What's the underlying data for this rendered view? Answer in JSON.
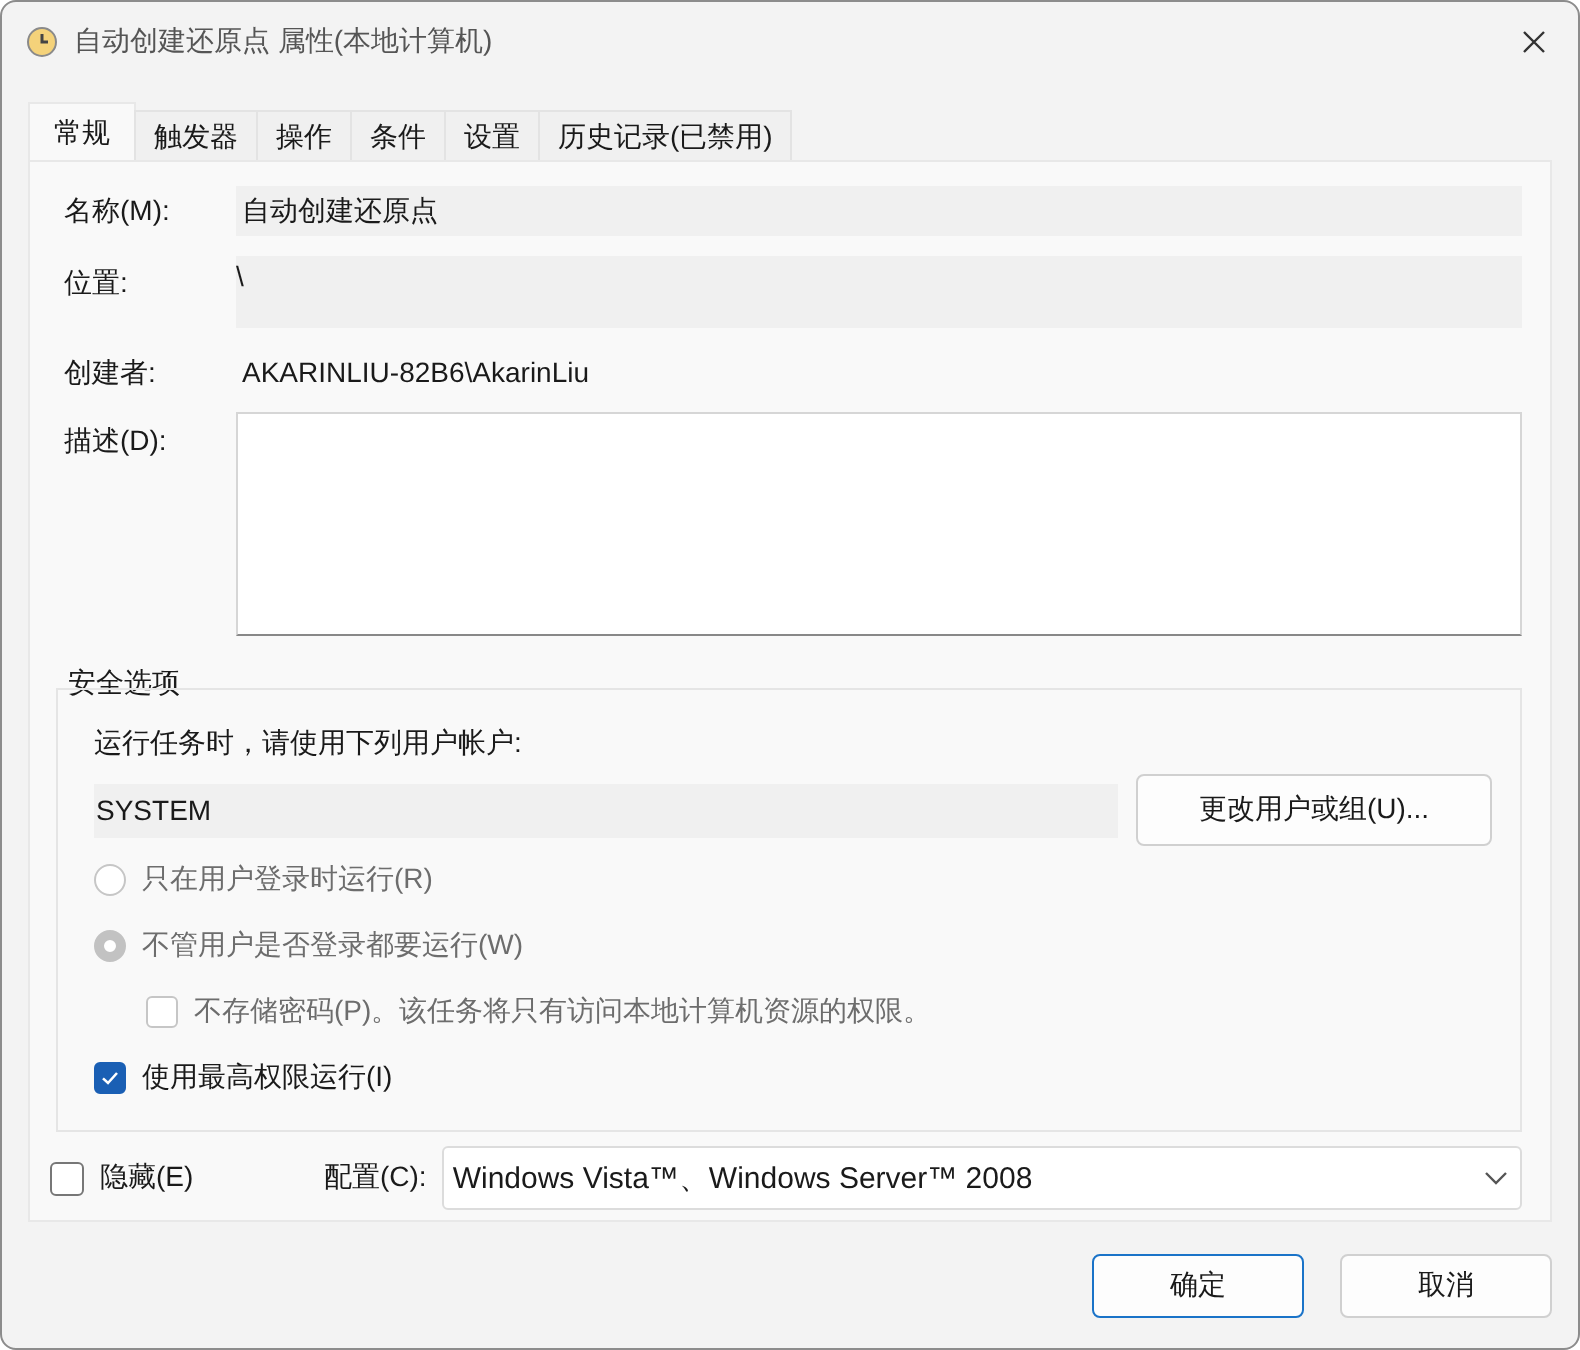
{
  "window": {
    "title": "自动创建还原点 属性(本地计算机)"
  },
  "tabs": [
    {
      "label": "常规",
      "selected": true
    },
    {
      "label": "触发器",
      "selected": false
    },
    {
      "label": "操作",
      "selected": false
    },
    {
      "label": "条件",
      "selected": false
    },
    {
      "label": "设置",
      "selected": false
    },
    {
      "label": "历史记录(已禁用)",
      "selected": false
    }
  ],
  "fields": [
    {
      "kind": "readonly",
      "label": "名称(M):",
      "value": "自动创建还原点"
    },
    {
      "kind": "tall",
      "label": "位置:",
      "value": "\\"
    },
    {
      "kind": "plain",
      "label": "创建者:",
      "value": "AKARINLIU-82B6\\AkarinLiu"
    },
    {
      "kind": "textarea",
      "label": "描述(D):"
    }
  ],
  "security": {
    "title": "安全选项",
    "prompt": "运行任务时，请使用下列用户帐户:",
    "account": "SYSTEM",
    "change_button": "更改用户或组(U)...",
    "options": [
      {
        "kind": "radio",
        "label": "只在用户登录时运行(R)",
        "selected": false,
        "disabled": true
      },
      {
        "kind": "radio",
        "label": "不管用户是否登录都要运行(W)",
        "selected": true,
        "disabled": true,
        "children": [
          {
            "kind": "checkbox",
            "label": "不存储密码(P)。该任务将只有访问本地计算机资源的权限。",
            "checked": false,
            "disabled": true
          }
        ]
      },
      {
        "kind": "checkbox",
        "label": "使用最高权限运行(I)",
        "checked": true,
        "disabled": false
      }
    ]
  },
  "hidden": {
    "label": "隐藏(E)",
    "checked": false
  },
  "config": {
    "label": "配置(C):",
    "value": "Windows Vista™、Windows Server™ 2008"
  },
  "buttons": [
    {
      "label": "确定",
      "default": true
    },
    {
      "label": "取消",
      "default": false
    }
  ]
}
